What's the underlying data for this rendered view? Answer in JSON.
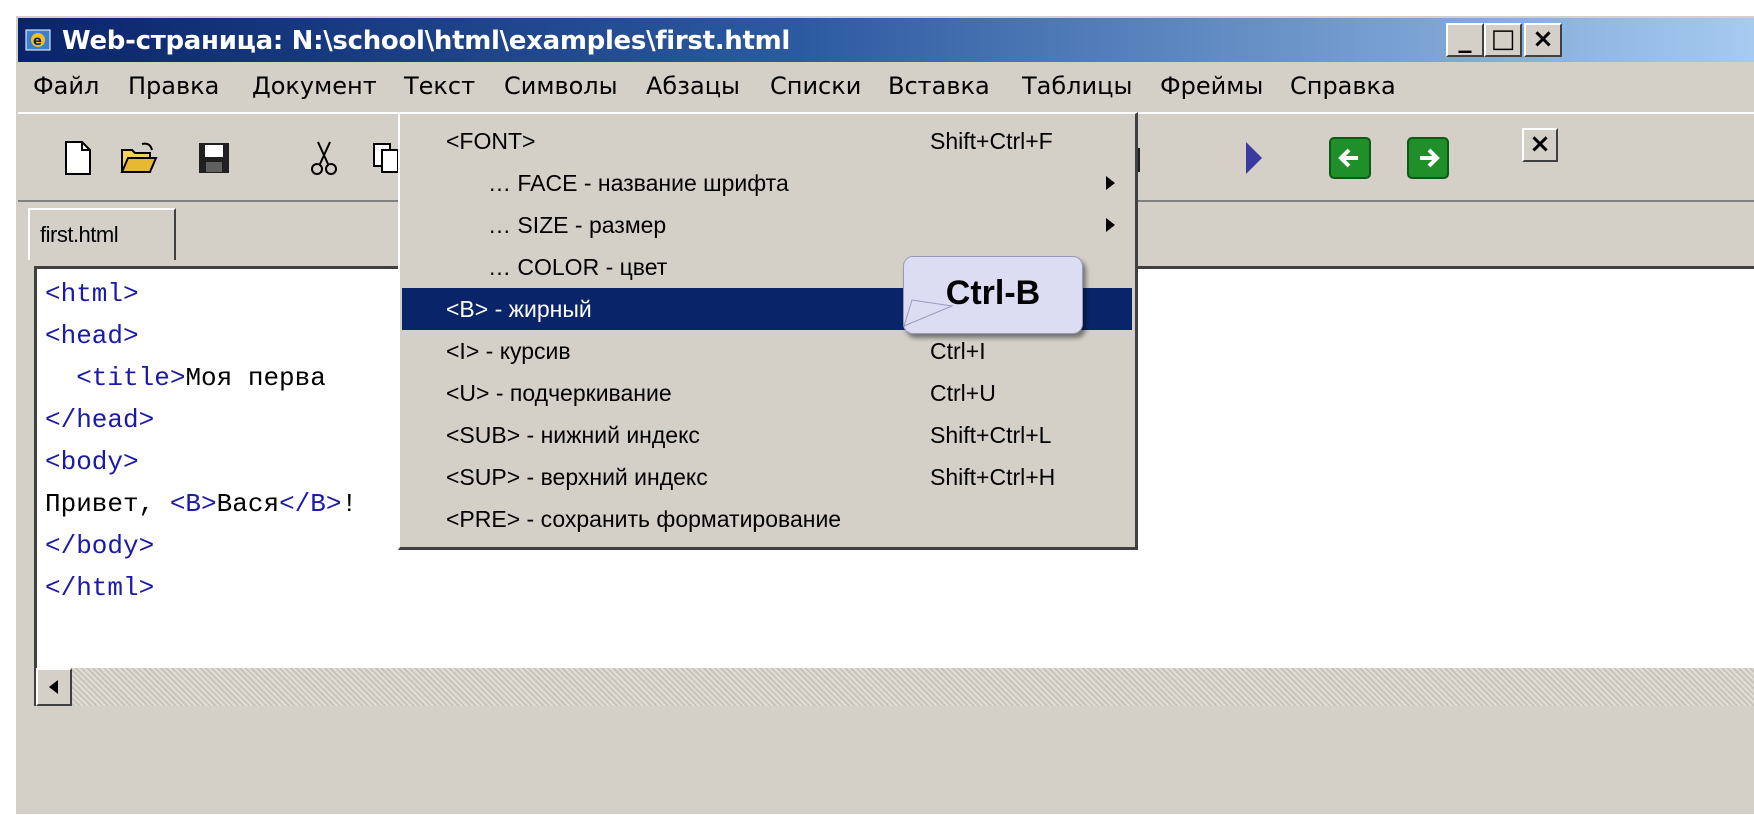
{
  "window": {
    "title": "Web-страница: N:\\school\\html\\examples\\first.html"
  },
  "window_controls": {
    "minimize": "_",
    "maximize": "□",
    "close": "×"
  },
  "menubar": [
    "Файл",
    "Правка",
    "Документ",
    "Текст",
    "Символы",
    "Абзацы",
    "Списки",
    "Вставка",
    "Таблицы",
    "Фреймы",
    "Справка"
  ],
  "toolbar": {
    "icons": [
      "new-file-icon",
      "open-folder-icon",
      "save-icon",
      "cut-icon",
      "copy-icon",
      "play-icon",
      "back-arrow-icon",
      "forward-arrow-icon",
      "close-icon"
    ],
    "close_label": "×",
    "accent_green": "#1f8f2a",
    "play_color": "#3a3aa0"
  },
  "tabs": [
    {
      "label": "first.html"
    }
  ],
  "editor": {
    "lines": [
      [
        {
          "t": "<html>",
          "k": "tag"
        }
      ],
      [
        {
          "t": "<head>",
          "k": "tag"
        }
      ],
      [
        {
          "t": "  <title>",
          "k": "tag"
        },
        {
          "t": "Моя перва",
          "k": "txt"
        }
      ],
      [
        {
          "t": "</head>",
          "k": "tag"
        }
      ],
      [
        {
          "t": "<body>",
          "k": "tag"
        }
      ],
      [
        {
          "t": "Привет, ",
          "k": "txt"
        },
        {
          "t": "<B>",
          "k": "tag"
        },
        {
          "t": "Вася",
          "k": "txt"
        },
        {
          "t": "</B>",
          "k": "tag"
        },
        {
          "t": "!",
          "k": "txt"
        }
      ],
      [
        {
          "t": "</body>",
          "k": "tag"
        }
      ],
      [
        {
          "t": "</html>",
          "k": "tag"
        }
      ]
    ]
  },
  "dropdown": {
    "items": [
      {
        "label": "<FONT>",
        "shortcut": "Shift+Ctrl+F",
        "indent": false,
        "submenu": false,
        "selected": false
      },
      {
        "label": "… FACE - название шрифта",
        "shortcut": "",
        "indent": true,
        "submenu": true,
        "selected": false
      },
      {
        "label": "… SIZE - размер",
        "shortcut": "",
        "indent": true,
        "submenu": true,
        "selected": false
      },
      {
        "label": "… COLOR - цвет",
        "shortcut": "",
        "indent": true,
        "submenu": false,
        "selected": false
      },
      {
        "label": "<B> - жирный",
        "shortcut": "",
        "indent": false,
        "submenu": false,
        "selected": true
      },
      {
        "label": "<I> - курсив",
        "shortcut": "Ctrl+I",
        "indent": false,
        "submenu": false,
        "selected": false
      },
      {
        "label": "<U> - подчеркивание",
        "shortcut": "Ctrl+U",
        "indent": false,
        "submenu": false,
        "selected": false
      },
      {
        "label": "<SUB> - нижний индекс",
        "shortcut": "Shift+Ctrl+L",
        "indent": false,
        "submenu": false,
        "selected": false
      },
      {
        "label": "<SUP> - верхний индекс",
        "shortcut": "Shift+Ctrl+H",
        "indent": false,
        "submenu": false,
        "selected": false
      },
      {
        "label": "<PRE> - сохранить форматирование",
        "shortcut": "",
        "indent": false,
        "submenu": false,
        "selected": false
      }
    ]
  },
  "callout": {
    "text": "Ctrl-B"
  },
  "colors": {
    "title_start": "#0a246a",
    "menu_selected": "#0a246a",
    "code_tag": "#1a1aa6",
    "chrome": "#d4d0c8"
  }
}
